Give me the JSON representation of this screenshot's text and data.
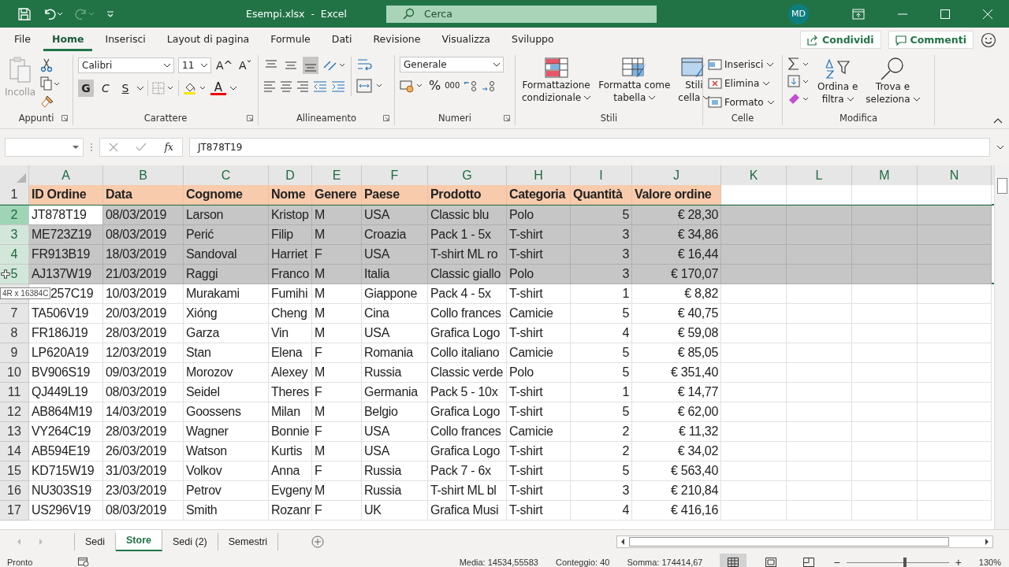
{
  "title_bar": {
    "quick_access": [
      {
        "kind": "save",
        "disabled": false
      },
      {
        "kind": "undo",
        "disabled": false
      },
      {
        "kind": "redo",
        "disabled": true
      }
    ],
    "title": "Esempi.xlsx  -  Excel",
    "search": {
      "placeholder": "Cerca"
    },
    "avatar": "MD"
  },
  "menu_tabs": [
    {
      "label": "File",
      "selected": false
    },
    {
      "label": "Home",
      "selected": true
    },
    {
      "label": "Inserisci",
      "selected": false
    },
    {
      "label": "Layout di pagina",
      "selected": false
    },
    {
      "label": "Formule",
      "selected": false
    },
    {
      "label": "Dati",
      "selected": false
    },
    {
      "label": "Revisione",
      "selected": false
    },
    {
      "label": "Visualizza",
      "selected": false
    },
    {
      "label": "Sviluppo",
      "selected": false
    }
  ],
  "share_button": "Condividi",
  "comments_button": "Commenti",
  "ribbon": {
    "clipboard": {
      "label": "Appunti",
      "paste": "Incolla",
      "paste_disabled": true
    },
    "font": {
      "label": "Carattere",
      "font_name": "Calibri",
      "font_size": "11",
      "grow": "A",
      "grow_mark": "^",
      "shrink": "A",
      "shrink_mark": "ˇ",
      "font_color": "A",
      "styles": [
        {
          "text": "G",
          "pressed": true
        },
        {
          "text": "C",
          "pressed": false
        },
        {
          "text": "S",
          "pressed": false
        }
      ]
    },
    "alignment": {
      "label": "Allineamento",
      "vertical": [
        {
          "kind": "top",
          "pressed": false
        },
        {
          "kind": "middle",
          "pressed": false
        },
        {
          "kind": "bottom",
          "pressed": true
        }
      ]
    },
    "number": {
      "label": "Numeri",
      "format": "Generale",
      "percent": "%",
      "thousands": "000"
    },
    "styles": {
      "label": "Stili",
      "buttons": [
        {
          "kind": "conditional",
          "lines": [
            "Formattazione",
            "condizionale"
          ]
        },
        {
          "kind": "table",
          "lines": [
            "Formatta come",
            "tabella"
          ]
        },
        {
          "kind": "cellstyle",
          "lines": [
            "Stili",
            "cella"
          ]
        }
      ]
    },
    "cells": {
      "label": "Celle",
      "buttons": [
        {
          "kind": "insert",
          "label": "Inserisci"
        },
        {
          "kind": "delete",
          "label": "Elimina"
        },
        {
          "kind": "format",
          "label": "Formato"
        }
      ]
    },
    "editing": {
      "label": "Modifica",
      "buttons": [
        {
          "kind": "sort",
          "lines": [
            "Ordina e",
            "filtra"
          ]
        },
        {
          "kind": "find",
          "lines": [
            "Trova e",
            "seleziona"
          ]
        }
      ]
    }
  },
  "formula_bar": {
    "fx": "fx",
    "value": "JT878T19"
  },
  "sheet": {
    "columns": [
      "A",
      "B",
      "C",
      "D",
      "E",
      "F",
      "G",
      "H",
      "I",
      "J",
      "K",
      "L",
      "M",
      "N"
    ],
    "header_row": {
      "number": "1",
      "cells": [
        "ID Ordine",
        "Data",
        "Cognome",
        "Nome",
        "Genere",
        "Paese",
        "Prodotto",
        "Categoria",
        "Quantità",
        "Valore ordine"
      ]
    },
    "rows": [
      {
        "number": "2",
        "selected": true,
        "active": true,
        "cells": [
          "JT878T19",
          "08/03/2019",
          "Larson",
          "Kristop",
          "M",
          "USA",
          "Classic blu",
          "Polo",
          "5",
          "€ 28,30"
        ]
      },
      {
        "number": "3",
        "selected": true,
        "active": false,
        "cells": [
          "ME723Z19",
          "08/03/2019",
          "Perić",
          "Filip",
          "M",
          "Croazia",
          "Pack 1 - 5x",
          "T-shirt",
          "3",
          "€ 34,86"
        ]
      },
      {
        "number": "4",
        "selected": true,
        "active": false,
        "cells": [
          "FR913B19",
          "18/03/2019",
          "Sandoval",
          "Harriet",
          "F",
          "USA",
          "T-shirt ML ro",
          "T-shirt",
          "3",
          "€ 16,44"
        ]
      },
      {
        "number": "5",
        "selected": true,
        "active": false,
        "cells": [
          "AJ137W19",
          "21/03/2019",
          "Raggi",
          "Franco",
          "M",
          "Italia",
          "Classic giallo",
          "Polo",
          "3",
          "€ 170,07"
        ]
      },
      {
        "selected": false,
        "active": false,
        "cells": [
          "257C19",
          "10/03/2019",
          "Murakami",
          "Fumihi",
          "M",
          "Giappone",
          "Pack 4 - 5x",
          "T-shirt",
          "1",
          "€ 8,82"
        ]
      },
      {
        "number": "7",
        "selected": false,
        "active": false,
        "cells": [
          "TA506V19",
          "20/03/2019",
          "Xióng",
          "Cheng",
          "M",
          "Cina",
          "Collo frances",
          "Camicie",
          "5",
          "€ 40,75"
        ]
      },
      {
        "number": "8",
        "selected": false,
        "active": false,
        "cells": [
          "FR186J19",
          "28/03/2019",
          "Garza",
          "Vin",
          "M",
          "USA",
          "Grafica Logo",
          "T-shirt",
          "4",
          "€ 59,08"
        ]
      },
      {
        "number": "9",
        "selected": false,
        "active": false,
        "cells": [
          "LP620A19",
          "12/03/2019",
          "Stan",
          "Elena",
          "F",
          "Romania",
          "Collo italiano",
          "Camicie",
          "5",
          "€ 85,05"
        ]
      },
      {
        "number": "10",
        "selected": false,
        "active": false,
        "cells": [
          "BV906S19",
          "09/03/2019",
          "Morozov",
          "Alexey",
          "M",
          "Russia",
          "Classic verde",
          "Polo",
          "5",
          "€ 351,40"
        ]
      },
      {
        "number": "11",
        "selected": false,
        "active": false,
        "cells": [
          "QJ449L19",
          "08/03/2019",
          "Seidel",
          "Theres",
          "F",
          "Germania",
          "Pack 5 - 10x",
          "T-shirt",
          "1",
          "€ 14,77"
        ]
      },
      {
        "number": "12",
        "selected": false,
        "active": false,
        "cells": [
          "AB864M19",
          "14/03/2019",
          "Goossens",
          "Milan",
          "M",
          "Belgio",
          "Grafica Logo",
          "T-shirt",
          "5",
          "€ 62,00"
        ]
      },
      {
        "number": "13",
        "selected": false,
        "active": false,
        "cells": [
          "VY264C19",
          "28/03/2019",
          "Wagner",
          "Bonnie",
          "F",
          "USA",
          "Collo frances",
          "Camicie",
          "2",
          "€ 11,32"
        ]
      },
      {
        "number": "14",
        "selected": false,
        "active": false,
        "cells": [
          "AB594E19",
          "26/03/2019",
          "Watson",
          "Kurtis",
          "M",
          "USA",
          "Grafica Logo",
          "T-shirt",
          "2",
          "€ 34,02"
        ]
      },
      {
        "number": "15",
        "selected": false,
        "active": false,
        "cells": [
          "KD715W19",
          "31/03/2019",
          "Volkov",
          "Anna",
          "F",
          "Russia",
          "Pack 7 - 6x",
          "T-shirt",
          "5",
          "€ 563,40"
        ]
      },
      {
        "number": "16",
        "selected": false,
        "active": false,
        "cells": [
          "NU303S19",
          "23/03/2019",
          "Petrov",
          "Evgeny",
          "M",
          "Russia",
          "T-shirt ML bl",
          "T-shirt",
          "3",
          "€ 210,84"
        ]
      },
      {
        "number": "17",
        "selected": false,
        "active": false,
        "cells": [
          "US296V19",
          "08/03/2019",
          "Smith",
          "Rozanr",
          "F",
          "UK",
          "Grafica Musi",
          "T-shirt",
          "4",
          "€ 416,16"
        ]
      }
    ],
    "selection_tooltip": "4R x 16384C"
  },
  "sheet_tabs": [
    {
      "label": "Sedi",
      "selected": false
    },
    {
      "label": "Store",
      "selected": true
    },
    {
      "label": "Sedi (2)",
      "selected": false
    },
    {
      "label": "Semestri",
      "selected": false
    }
  ],
  "status_bar": {
    "status": "Pronto",
    "average": "Media: 14534,55583",
    "count": "Conteggio: 40",
    "sum": "Somma: 174414,67",
    "views": [
      {
        "kind": "normal",
        "selected": true
      },
      {
        "kind": "layout",
        "selected": false
      },
      {
        "kind": "pagebreak",
        "selected": false
      }
    ],
    "zoom": {
      "out": "−",
      "in": "+",
      "level": 0.57,
      "reading": "130%"
    }
  }
}
